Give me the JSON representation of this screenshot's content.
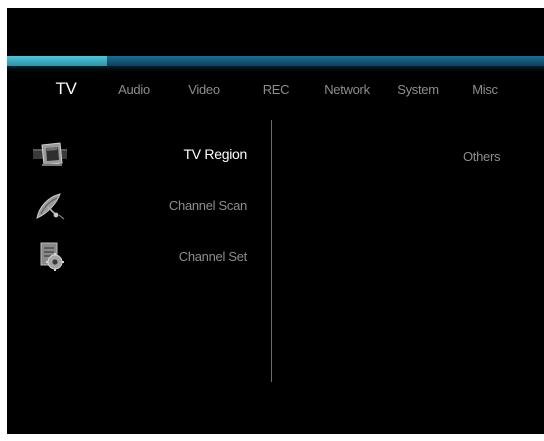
{
  "tabs": [
    {
      "label": "TV",
      "active": true
    },
    {
      "label": "Audio",
      "active": false
    },
    {
      "label": "Video",
      "active": false
    },
    {
      "label": "REC",
      "active": false
    },
    {
      "label": "Network",
      "active": false
    },
    {
      "label": "System",
      "active": false
    },
    {
      "label": "Misc",
      "active": false
    }
  ],
  "menu": {
    "items": [
      {
        "label": "TV Region",
        "icon": "tv-region-icon",
        "active": true
      },
      {
        "label": "Channel Scan",
        "icon": "satellite-dish-icon",
        "active": false
      },
      {
        "label": "Channel Set",
        "icon": "settings-document-icon",
        "active": false
      }
    ]
  },
  "right_panel": {
    "value": "Others"
  },
  "colors": {
    "background": "#000000",
    "header_band": "#1a6f96",
    "header_accent": "#4fc6d8",
    "active_text": "#ffffff",
    "inactive_text": "#8d8d8d"
  }
}
